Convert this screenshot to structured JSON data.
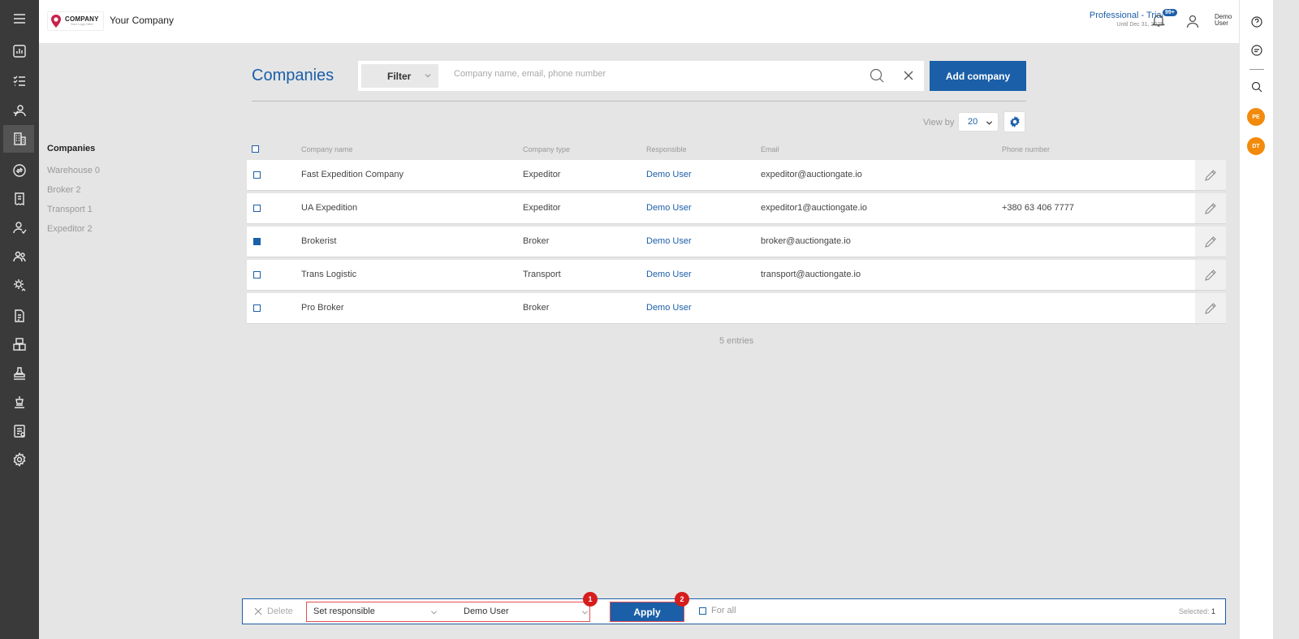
{
  "header": {
    "logo_main": "COMPANY",
    "logo_sub": "Your Logo Here",
    "company_name": "Your Company",
    "plan_title": "Professional - Trial",
    "plan_until": "Until Dec 31, 2025",
    "notification_badge": "99+",
    "user_name": "Demo User"
  },
  "left_sidebar_icons": [
    "menu-icon",
    "dashboard-icon",
    "tasks-icon",
    "contacts-icon",
    "companies-icon",
    "exchange-icon",
    "invoice-icon",
    "person-icon",
    "team-icon",
    "settings-user-icon",
    "document-icon",
    "warehouse-icon",
    "stamp-icon",
    "auction-icon",
    "report-icon",
    "gear-icon"
  ],
  "right_sidebar": {
    "avatars": [
      "PE",
      "DT"
    ]
  },
  "subnav": {
    "title": "Companies",
    "items": [
      "Warehouse 0",
      "Broker 2",
      "Transport 1",
      "Expeditor 2"
    ]
  },
  "toolbar": {
    "page_title": "Companies",
    "filter_label": "Filter",
    "search_placeholder": "Company name, email, phone number",
    "add_label": "Add company",
    "viewby_label": "View by",
    "viewby_value": "20"
  },
  "table": {
    "columns": [
      "Company name",
      "Company type",
      "Responsible",
      "Email",
      "Phone number"
    ],
    "rows": [
      {
        "name": "Fast Expedition Company",
        "type": "Expeditor",
        "responsible": "Demo User",
        "email": "expeditor@auctiongate.io",
        "phone": "",
        "checked": false
      },
      {
        "name": "UA Expedition",
        "type": "Expeditor",
        "responsible": "Demo User",
        "email": "expeditor1@auctiongate.io",
        "phone": "+380 63 406 7777",
        "checked": false
      },
      {
        "name": "Brokerist",
        "type": "Broker",
        "responsible": "Demo User",
        "email": "broker@auctiongate.io",
        "phone": "",
        "checked": true
      },
      {
        "name": "Trans Logistic",
        "type": "Transport",
        "responsible": "Demo User",
        "email": "transport@auctiongate.io",
        "phone": "",
        "checked": false
      },
      {
        "name": "Pro Broker",
        "type": "Broker",
        "responsible": "Demo User",
        "email": "",
        "phone": "",
        "checked": false
      }
    ],
    "entries": "5 entries"
  },
  "actionbar": {
    "delete_label": "Delete",
    "action_select": "Set responsible",
    "value_select": "Demo User",
    "apply_label": "Apply",
    "forall_label": "For all",
    "selected_label": "Selected:",
    "selected_count": "1",
    "markers": [
      "1",
      "2"
    ]
  },
  "colors": {
    "primary": "#1b5fa8",
    "sidebar": "#3a3a3a",
    "avatar": "#f28a0c",
    "marker": "#d61d1d"
  }
}
